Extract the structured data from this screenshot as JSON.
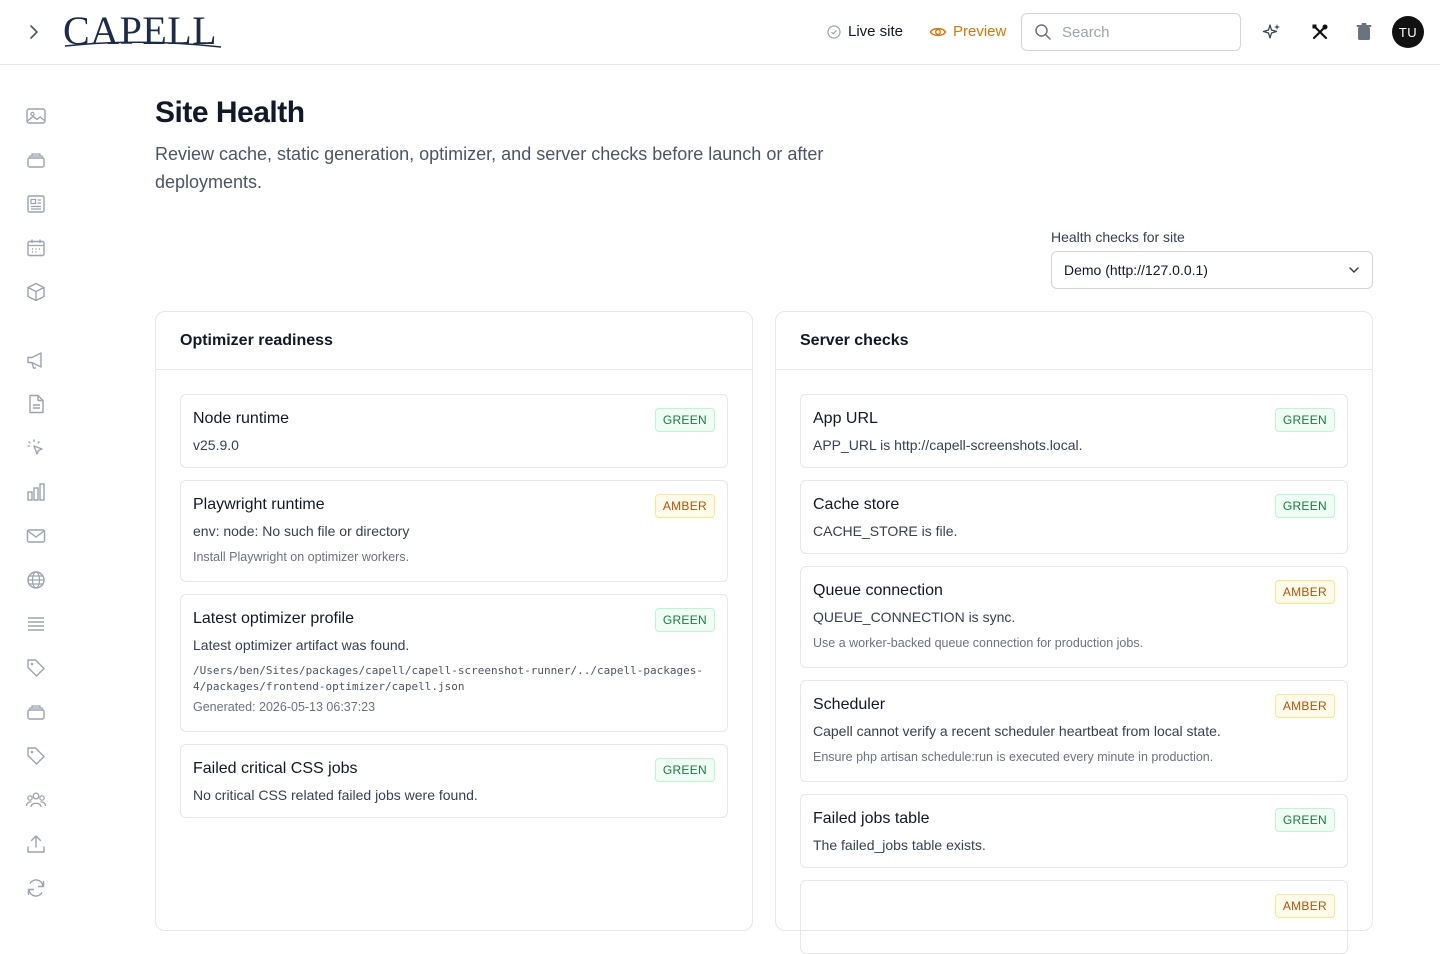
{
  "app": {
    "logo_text": "CAPELL",
    "live_site_label": "Live site",
    "preview_label": "Preview",
    "search_placeholder": "Search",
    "avatar_initials": "TU"
  },
  "colors": {
    "accent_preview": "#d97706",
    "status_green": "#15803d",
    "status_amber": "#b45309"
  },
  "sidebar": {
    "icons": [
      "image-icon",
      "layers-icon",
      "newspaper-icon",
      "calendar-icon",
      "cube-icon",
      "megaphone-icon",
      "document-icon",
      "cursor-click-icon",
      "bar-chart-icon",
      "mail-icon",
      "globe-icon",
      "list-icon",
      "tag-icon",
      "archive-icon",
      "tag-icon",
      "users-icon",
      "upload-icon",
      "refresh-icon"
    ]
  },
  "page": {
    "title": "Site Health",
    "description": "Review cache, static generation, optimizer, and server checks before launch or after deployments."
  },
  "site_select": {
    "label": "Health checks for site",
    "value": "Demo (http://127.0.0.1)"
  },
  "optimizer": {
    "heading": "Optimizer readiness",
    "checks": [
      {
        "title": "Node runtime",
        "status": "GREEN",
        "message": "v25.9.0"
      },
      {
        "title": "Playwright runtime",
        "status": "AMBER",
        "message": "env: node: No such file or directory",
        "note": "Install Playwright on optimizer workers."
      },
      {
        "title": "Latest optimizer profile",
        "status": "GREEN",
        "message": "Latest optimizer artifact was found.",
        "path": "/Users/ben/Sites/packages/capell/capell-screenshot-runner/../capell-packages-4/packages/frontend-optimizer/capell.json",
        "generated": "Generated: 2026-05-13 06:37:23"
      },
      {
        "title": "Failed critical CSS jobs",
        "status": "GREEN",
        "message": "No critical CSS related failed jobs were found."
      }
    ]
  },
  "server": {
    "heading": "Server checks",
    "checks": [
      {
        "title": "App URL",
        "status": "GREEN",
        "message": "APP_URL is http://capell-screenshots.local."
      },
      {
        "title": "Cache store",
        "status": "GREEN",
        "message": "CACHE_STORE is file."
      },
      {
        "title": "Queue connection",
        "status": "AMBER",
        "message": "QUEUE_CONNECTION is sync.",
        "note": "Use a worker-backed queue connection for production jobs."
      },
      {
        "title": "Scheduler",
        "status": "AMBER",
        "message": "Capell cannot verify a recent scheduler heartbeat from local state.",
        "note": "Ensure php artisan schedule:run is executed every minute in production."
      },
      {
        "title": "Failed jobs table",
        "status": "GREEN",
        "message": "The failed_jobs table exists."
      },
      {
        "title": "",
        "status": "AMBER",
        "message": ""
      }
    ]
  }
}
